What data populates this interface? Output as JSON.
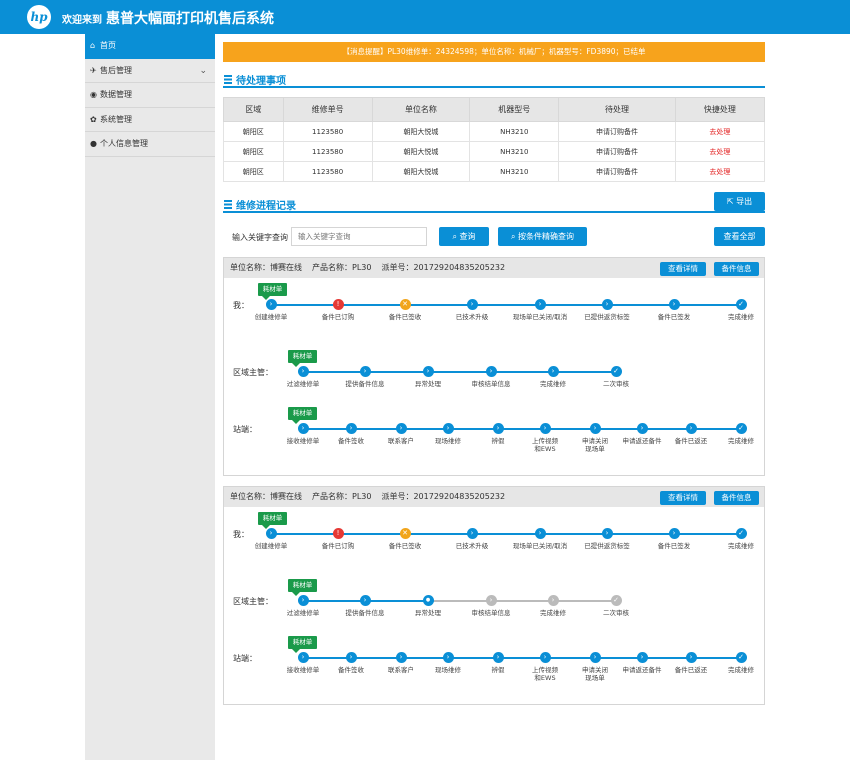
{
  "header": {
    "logo": "hp",
    "welcome": "欢迎来到",
    "title": "惠普大幅面打印机售后系统"
  },
  "sidebar": {
    "items": [
      {
        "icon": "home-icon",
        "label": "首页",
        "active": true
      },
      {
        "icon": "bird-icon",
        "label": "售后管理",
        "expandable": true
      },
      {
        "icon": "database-icon",
        "label": "数据管理"
      },
      {
        "icon": "gear-icon",
        "label": "系统管理"
      },
      {
        "icon": "person-icon",
        "label": "个人信息管理"
      }
    ]
  },
  "notice": "【消息提醒】PL30维修单：24324598；单位名称：机械厂；机器型号：FD3890；已结单",
  "pending": {
    "title": "待处理事项",
    "columns": [
      "区域",
      "维修单号",
      "单位名称",
      "机器型号",
      "待处理",
      "快捷处理"
    ],
    "rows": [
      [
        "朝阳区",
        "1123580",
        "朝阳大悦城",
        "NH3210",
        "申请订购备件",
        "去处理"
      ],
      [
        "朝阳区",
        "1123580",
        "朝阳大悦城",
        "NH3210",
        "申请订购备件",
        "去处理"
      ],
      [
        "朝阳区",
        "1123580",
        "朝阳大悦城",
        "NH3210",
        "申请订购备件",
        "去处理"
      ]
    ]
  },
  "records": {
    "title": "维修进程记录",
    "export_label": "导出",
    "search_label": "输入关键字查询",
    "search_placeholder": "输入关键字查询",
    "query_label": "查询",
    "precise_label": "按条件精确查询",
    "view_all_label": "查看全部"
  },
  "cards": [
    {
      "unit": "单位名称：博赛在线",
      "product": "产品名称：PL30",
      "order": "派单号：201729204835205232",
      "detail_label": "查看详情",
      "parts_label": "备件信息",
      "tag": "耗材单",
      "stages": [
        {
          "label": "我：",
          "steps": [
            {
              "t": "创建维修单",
              "s": "done"
            },
            {
              "t": "备件已订购",
              "s": "error"
            },
            {
              "t": "备件已签收",
              "s": "warn"
            },
            {
              "t": "已技术升级",
              "s": "done"
            },
            {
              "t": "现场单已关闭/取消",
              "s": "done"
            },
            {
              "t": "已提供返货标签",
              "s": "done"
            },
            {
              "t": "备件已签发",
              "s": "done"
            },
            {
              "t": "完成维修",
              "s": "complete"
            }
          ]
        },
        {
          "label": "区域主管：",
          "steps": [
            {
              "t": "过滤维修单",
              "s": "done"
            },
            {
              "t": "提供备件信息",
              "s": "done"
            },
            {
              "t": "异常处理",
              "s": "done"
            },
            {
              "t": "审核结单信息",
              "s": "done"
            },
            {
              "t": "完成维修",
              "s": "done"
            },
            {
              "t": "二次审核",
              "s": "complete"
            }
          ]
        },
        {
          "label": "站端：",
          "steps": [
            {
              "t": "接收维修单",
              "s": "done"
            },
            {
              "t": "备件签收",
              "s": "done"
            },
            {
              "t": "联系客户",
              "s": "done"
            },
            {
              "t": "现场维修",
              "s": "done"
            },
            {
              "t": "辨假",
              "s": "done"
            },
            {
              "t": "上传视频\n和EWS",
              "s": "done"
            },
            {
              "t": "申请关闭\n现场单",
              "s": "done"
            },
            {
              "t": "申请返还备件",
              "s": "done"
            },
            {
              "t": "备件已返还",
              "s": "done"
            },
            {
              "t": "完成维修",
              "s": "complete"
            }
          ]
        }
      ]
    },
    {
      "unit": "单位名称：博赛在线",
      "product": "产品名称：PL30",
      "order": "派单号：201729204835205232",
      "detail_label": "查看详情",
      "parts_label": "备件信息",
      "tag": "耗材单",
      "stages": [
        {
          "label": "我：",
          "steps": [
            {
              "t": "创建维修单",
              "s": "done"
            },
            {
              "t": "备件已订购",
              "s": "error"
            },
            {
              "t": "备件已签收",
              "s": "warn"
            },
            {
              "t": "已技术升级",
              "s": "done"
            },
            {
              "t": "现场单已关闭/取消",
              "s": "done"
            },
            {
              "t": "已提供返货标签",
              "s": "done"
            },
            {
              "t": "备件已签发",
              "s": "done"
            },
            {
              "t": "完成维修",
              "s": "complete"
            }
          ]
        },
        {
          "label": "区域主管：",
          "steps": [
            {
              "t": "过滤维修单",
              "s": "done"
            },
            {
              "t": "提供备件信息",
              "s": "done"
            },
            {
              "t": "异常处理",
              "s": "current"
            },
            {
              "t": "审核结单信息",
              "s": "pending"
            },
            {
              "t": "完成维修",
              "s": "pending"
            },
            {
              "t": "二次审核",
              "s": "pending-complete"
            }
          ]
        },
        {
          "label": "站端：",
          "steps": [
            {
              "t": "接收维修单",
              "s": "done"
            },
            {
              "t": "备件签收",
              "s": "done"
            },
            {
              "t": "联系客户",
              "s": "done"
            },
            {
              "t": "现场维修",
              "s": "done"
            },
            {
              "t": "辨假",
              "s": "done"
            },
            {
              "t": "上传视频\n和EWS",
              "s": "done"
            },
            {
              "t": "申请关闭\n现场单",
              "s": "done"
            },
            {
              "t": "申请返还备件",
              "s": "done"
            },
            {
              "t": "备件已返还",
              "s": "done"
            },
            {
              "t": "完成维修",
              "s": "complete"
            }
          ]
        }
      ]
    }
  ]
}
